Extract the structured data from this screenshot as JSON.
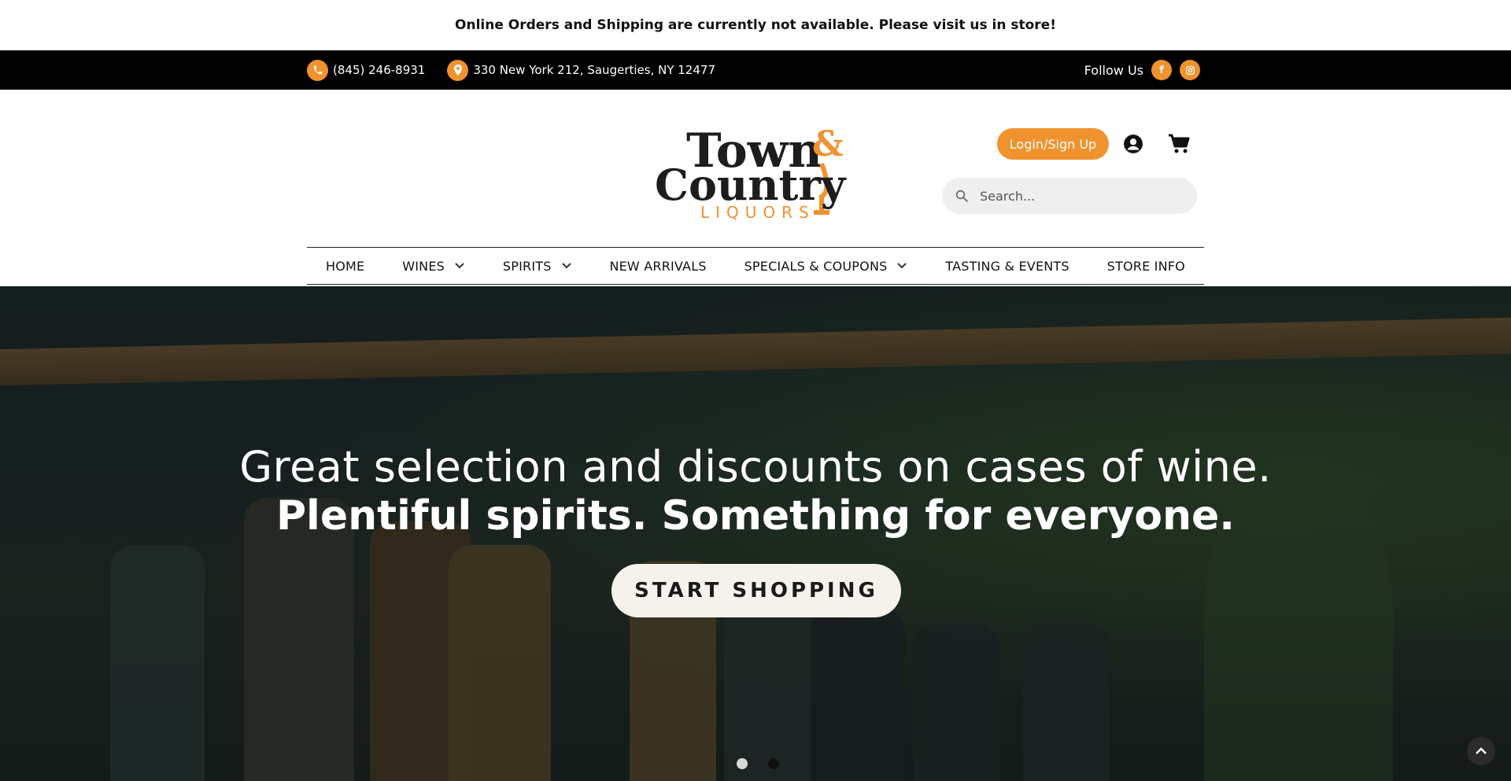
{
  "notice": {
    "text": "Online Orders and Shipping are currently not available. Please visit us in store!"
  },
  "contact": {
    "phone": "(845) 246-8931",
    "address": "330 New York 212, Saugerties, NY 12477",
    "follow_label": "Follow Us",
    "phone_icon": "phone-icon",
    "location_icon": "location-pin-icon",
    "social": [
      "facebook-icon",
      "instagram-icon"
    ]
  },
  "logo": {
    "line1": "Town",
    "ampersand": "&",
    "line2": "Country",
    "line3": "LIQUORS"
  },
  "header": {
    "login_label": "Login/Sign Up",
    "search_placeholder": "Search..."
  },
  "nav": {
    "items": [
      {
        "label": "HOME",
        "dropdown": false
      },
      {
        "label": "WINES",
        "dropdown": true
      },
      {
        "label": "SPIRITS",
        "dropdown": true
      },
      {
        "label": "NEW ARRIVALS",
        "dropdown": false
      },
      {
        "label": "SPECIALS & COUPONS",
        "dropdown": true
      },
      {
        "label": "TASTING & EVENTS",
        "dropdown": false
      },
      {
        "label": "STORE INFO",
        "dropdown": false
      }
    ]
  },
  "hero": {
    "line1": "Great selection and discounts on cases of wine.",
    "line2": "Plentiful spirits. Something for everyone.",
    "cta": "START SHOPPING",
    "slides": 2,
    "active_slide": 1
  },
  "colors": {
    "accent": "#f0922e",
    "dark": "#111111",
    "bar": "#000000"
  }
}
